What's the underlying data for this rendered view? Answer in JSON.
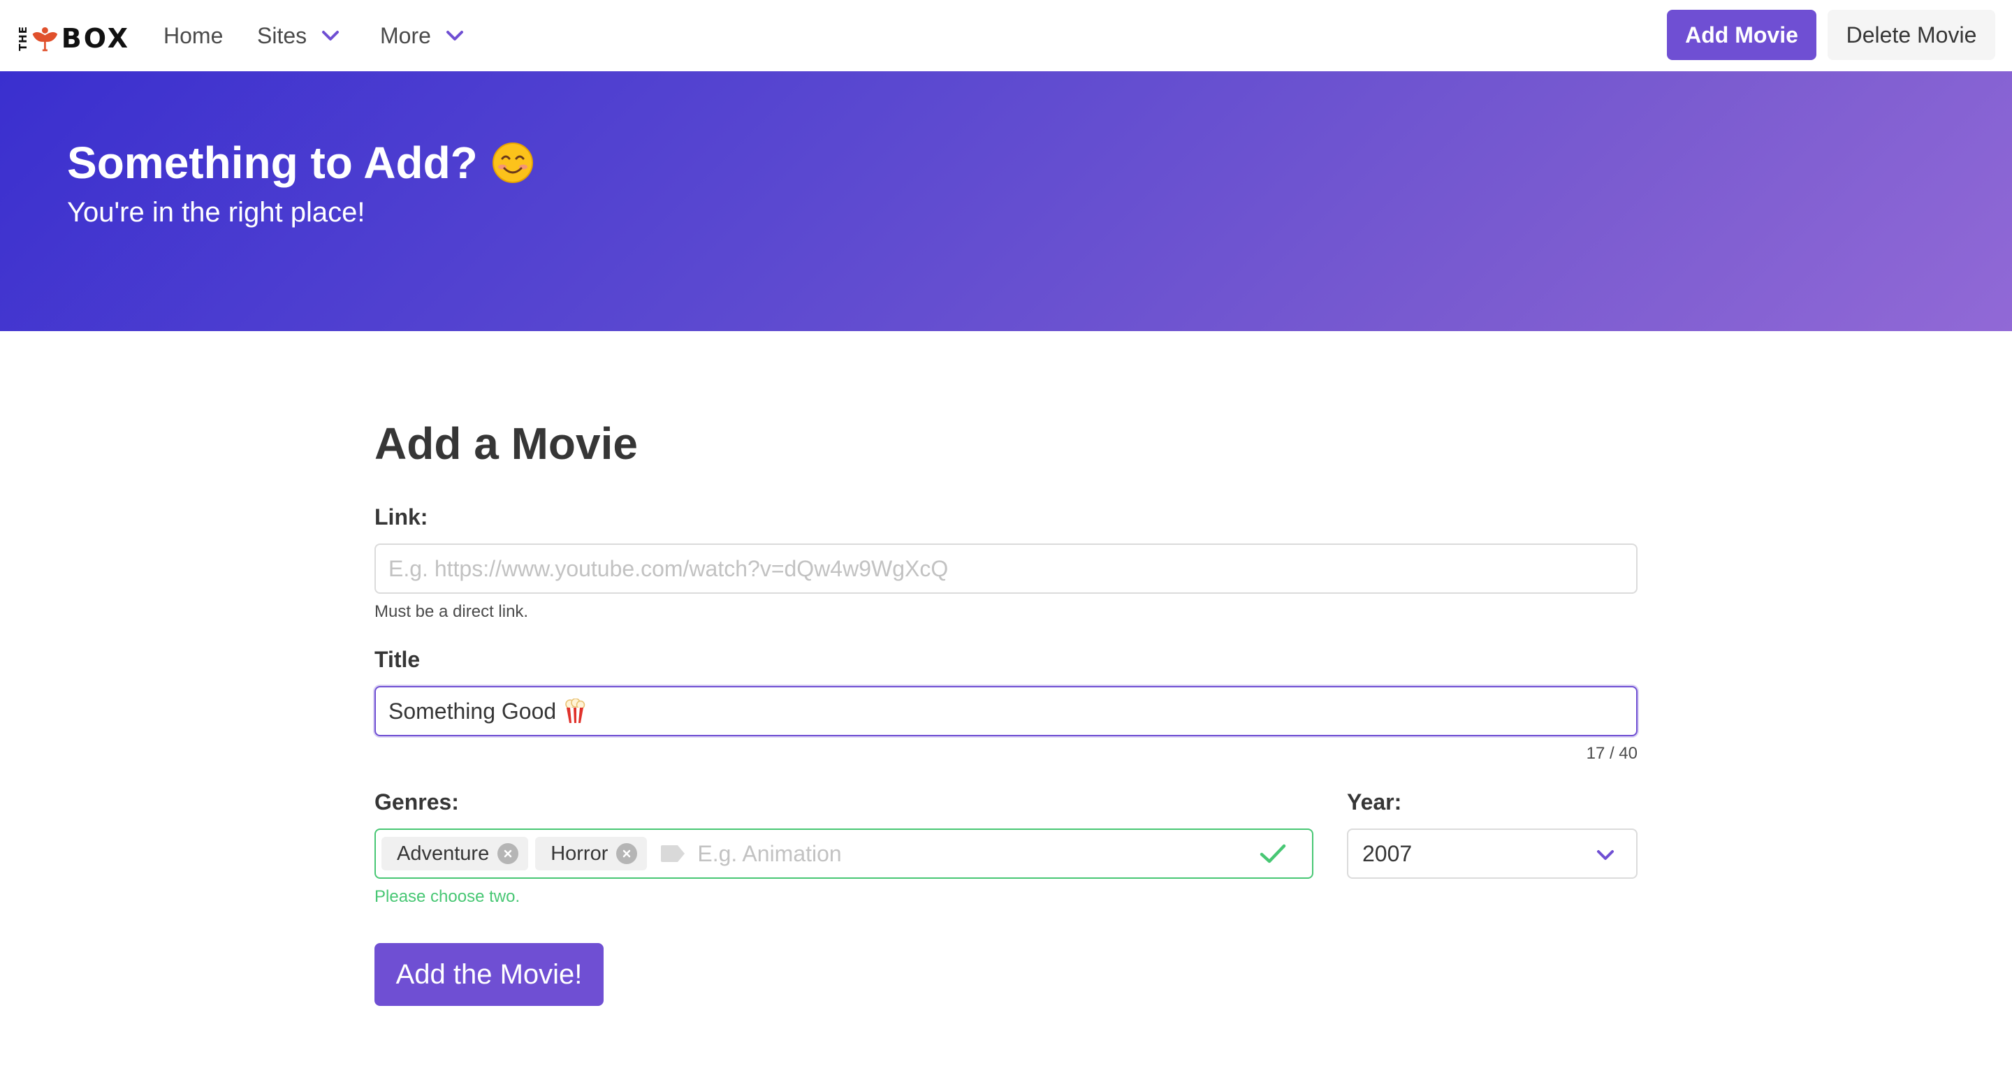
{
  "navbar": {
    "logo": {
      "small": "THE",
      "big": "BOX"
    },
    "items": [
      {
        "label": "Home"
      },
      {
        "label": "Sites",
        "icon": "chevron-down-icon"
      },
      {
        "label": "More",
        "icon": "chevron-down-icon"
      }
    ],
    "primary_button": "Add Movie",
    "secondary_button": "Delete Movie"
  },
  "hero": {
    "title": "Something to Add?",
    "title_emoji": "smiling-face-icon",
    "subtitle": "You're in the right place!"
  },
  "form": {
    "heading": "Add a Movie",
    "link": {
      "label": "Link:",
      "value": "",
      "placeholder": "E.g. https://www.youtube.com/watch?v=dQw4w9WgXcQ",
      "help": "Must be a direct link."
    },
    "title": {
      "label": "Title",
      "value": "Something Good",
      "emoji": "popcorn-icon",
      "counter": "17 / 40"
    },
    "genres": {
      "label": "Genres:",
      "tags": [
        "Adventure",
        "Horror"
      ],
      "placeholder": "E.g. Animation",
      "help": "Please choose two."
    },
    "year": {
      "label": "Year:",
      "value": "2007"
    },
    "submit": "Add the Movie!"
  },
  "colors": {
    "primary": "#6f4fd3",
    "success": "#48c774",
    "hero_start": "#3a2fcf",
    "hero_end": "#9169d6"
  }
}
